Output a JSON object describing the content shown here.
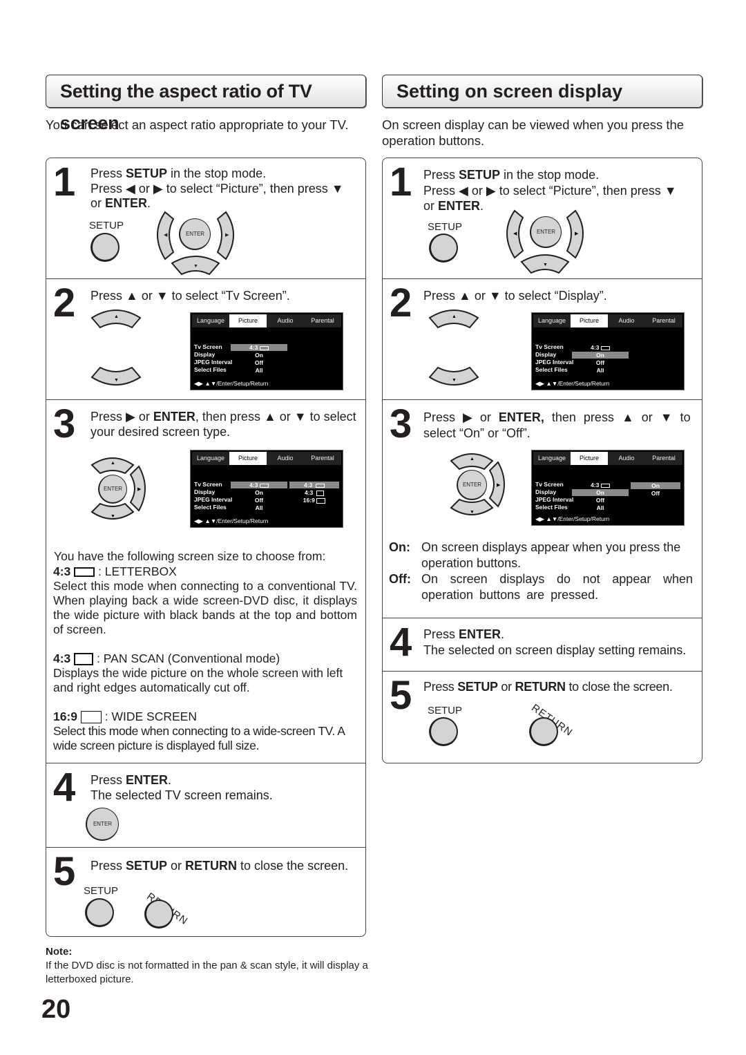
{
  "left": {
    "title": "Setting the aspect ratio of TV screen",
    "intro": "You can select an aspect ratio appropriate to your TV.",
    "steps": [
      {
        "num": "1",
        "line1a": "Press ",
        "line1b": "SETUP",
        "line1c": " in the stop mode.",
        "line2": "Press ◀ or ▶ to select “Picture”, then press ▼",
        "line3a": "or  ",
        "line3b": "ENTER",
        "line3c": "."
      },
      {
        "num": "2",
        "line1": "Press ▲ or ▼ to select “Tv Screen”."
      },
      {
        "num": "3",
        "line1a": "Press ▶ or ",
        "line1b": "ENTER",
        "line1c": ", then press ▲ or ▼ to select",
        "line2": "your desired screen type."
      },
      {
        "num": "4",
        "line1a": "Press ",
        "line1b": "ENTER",
        "line1c": ".",
        "line2": "The selected TV screen remains."
      },
      {
        "num": "5",
        "line1a": "Press ",
        "line1b": "SETUP",
        "line1c": " or ",
        "line1d": "RETURN",
        "line1e": " to close the screen."
      }
    ],
    "choose_intro": "You have the following screen size to choose from:",
    "modes": [
      {
        "ratio": "4:3",
        "name": ": LETTERBOX",
        "desc": "Select this mode when connecting to a conventional TV. When playing back a wide screen-DVD disc, it displays the wide picture with black bands at the top and bottom of screen."
      },
      {
        "ratio": "4:3",
        "name": ": PAN SCAN (Conventional mode)",
        "desc": "Displays the wide picture on the whole screen with left and right edges automatically cut off."
      },
      {
        "ratio": "16:9",
        "name": ": WIDE SCREEN",
        "desc": "Select this mode when connecting to a wide-screen TV. A wide screen picture is displayed full size."
      }
    ],
    "note_title": "Note:",
    "note_text": "If the DVD disc is not formatted in the pan & scan style, it will display a letterboxed picture."
  },
  "right": {
    "title": "Setting on screen display",
    "intro": "On screen display can be viewed when you press the operation buttons.",
    "steps": [
      {
        "num": "1",
        "line1a": "Press ",
        "line1b": "SETUP",
        "line1c": " in the stop mode.",
        "line2": "Press ◀ or ▶ to select “Picture”, then press ▼",
        "line3a": "or ",
        "line3b": "ENTER",
        "line3c": "."
      },
      {
        "num": "2",
        "line1": "Press ▲ or ▼ to select “Display”."
      },
      {
        "num": "3",
        "line1a": "Press ▶ or ",
        "line1b": "ENTER,",
        "line1c": " then press ▲ or ▼ to",
        "line2": "select “On” or “Off”."
      },
      {
        "num": "4",
        "line1a": "Press ",
        "line1b": "ENTER",
        "line1c": ".",
        "line2": "The selected on screen display setting remains."
      },
      {
        "num": "5",
        "line1a": "Press ",
        "line1b": "SETUP",
        "line1c": " or ",
        "line1d": "RETURN",
        "line1e": " to close the screen."
      }
    ],
    "on_label": "On:",
    "on_desc": "On screen displays appear when you press the operation buttons.",
    "off_label": "Off:",
    "off_desc": "On screen displays do not appear when operation buttons are pressed."
  },
  "buttons": {
    "setup": "SETUP",
    "enter": "ENTER",
    "return": "RETURN",
    "left": "◀",
    "right": "▶",
    "up": "▲",
    "down": "▼"
  },
  "osd": {
    "tabs": [
      "Language",
      "Picture",
      "Audio",
      "Parental"
    ],
    "selected_tab": "Picture",
    "rows": [
      "Tv Screen",
      "Display",
      "JPEG Interval",
      "Select Files"
    ],
    "values": [
      "4:3",
      "On",
      "Off",
      "All"
    ],
    "tv_options": [
      "4:3",
      "4:3",
      "16:9"
    ],
    "display_options": [
      "On",
      "Off"
    ],
    "footer": "◀▶ ▲▼/Enter/Setup/Return"
  },
  "page_number": "20"
}
